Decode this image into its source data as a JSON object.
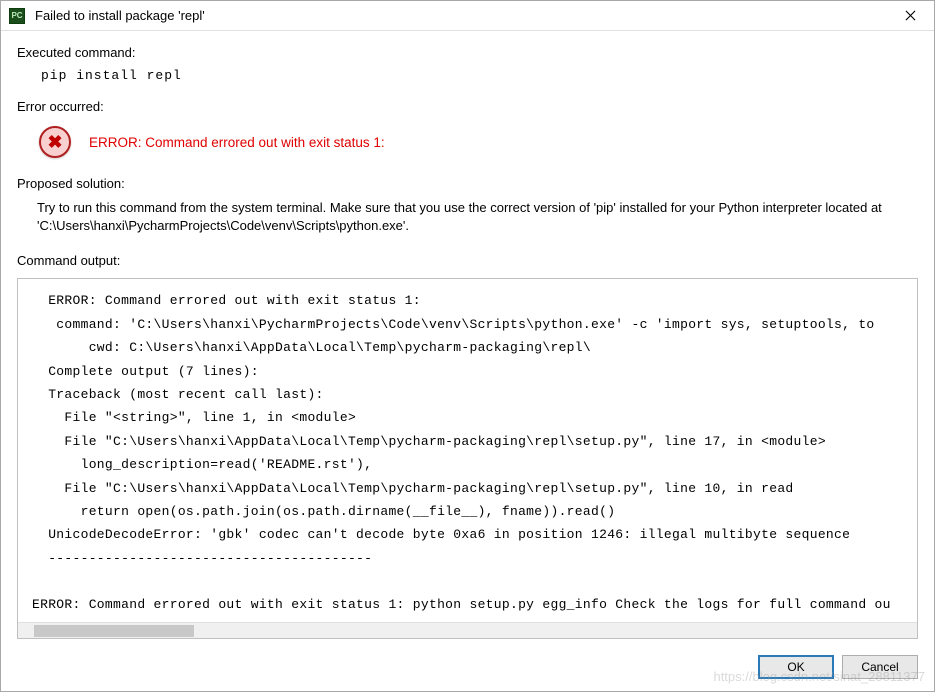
{
  "titlebar": {
    "title": "Failed to install package 'repl'"
  },
  "sections": {
    "executed_label": "Executed command:",
    "command": "pip install repl",
    "error_label": "Error occurred:",
    "error_message": "ERROR: Command errored out with exit status 1:",
    "proposed_label": "Proposed solution:",
    "solution_text": "Try to run this command from the system terminal. Make sure that you use the correct version of 'pip' installed for your Python interpreter located at 'C:\\Users\\hanxi\\PycharmProjects\\Code\\venv\\Scripts\\python.exe'.",
    "output_label": "Command output:"
  },
  "output": "  ERROR: Command errored out with exit status 1:\n   command: 'C:\\Users\\hanxi\\PycharmProjects\\Code\\venv\\Scripts\\python.exe' -c 'import sys, setuptools, to\n       cwd: C:\\Users\\hanxi\\AppData\\Local\\Temp\\pycharm-packaging\\repl\\\n  Complete output (7 lines):\n  Traceback (most recent call last):\n    File \"<string>\", line 1, in <module>\n    File \"C:\\Users\\hanxi\\AppData\\Local\\Temp\\pycharm-packaging\\repl\\setup.py\", line 17, in <module>\n      long_description=read('README.rst'),\n    File \"C:\\Users\\hanxi\\AppData\\Local\\Temp\\pycharm-packaging\\repl\\setup.py\", line 10, in read\n      return open(os.path.join(os.path.dirname(__file__), fname)).read()\n  UnicodeDecodeError: 'gbk' codec can't decode byte 0xa6 in position 1246: illegal multibyte sequence\n  ----------------------------------------\n\nERROR: Command errored out with exit status 1: python setup.py egg_info Check the logs for full command ou",
  "buttons": {
    "ok": "OK",
    "cancel": "Cancel"
  },
  "watermark": "https://blog.csdn.net/sinat_28811377"
}
